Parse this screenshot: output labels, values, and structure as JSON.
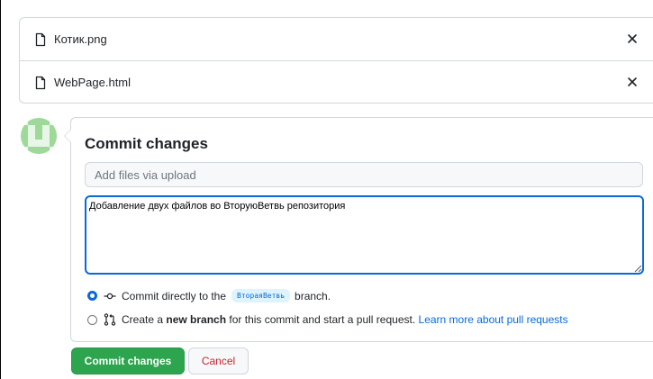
{
  "files": [
    {
      "name": "Котик.png",
      "icon": "file-icon",
      "remove_icon": "close-icon"
    },
    {
      "name": "WebPage.html",
      "icon": "file-icon",
      "remove_icon": "close-icon"
    }
  ],
  "commit": {
    "title": "Commit changes",
    "summary_placeholder": "Add files via upload",
    "summary_value": "",
    "description_value": "Добавление двух файлов во ВторуюВетвь репозитория"
  },
  "options": {
    "direct": {
      "selected": true,
      "icon": "git-commit-icon",
      "text_before": "Commit directly to the",
      "branch": "ВтораяВетвь",
      "text_after": "branch."
    },
    "new_branch": {
      "selected": false,
      "icon": "git-pull-request-icon",
      "text_before": "Create a",
      "text_bold": "new branch",
      "text_after": "for this commit and start a pull request.",
      "link": "Learn more about pull requests"
    }
  },
  "buttons": {
    "commit_label": "Commit changes",
    "cancel_label": "Cancel"
  },
  "colors": {
    "primary": "#2da44e",
    "accent": "#0969da",
    "danger": "#cf222e"
  }
}
